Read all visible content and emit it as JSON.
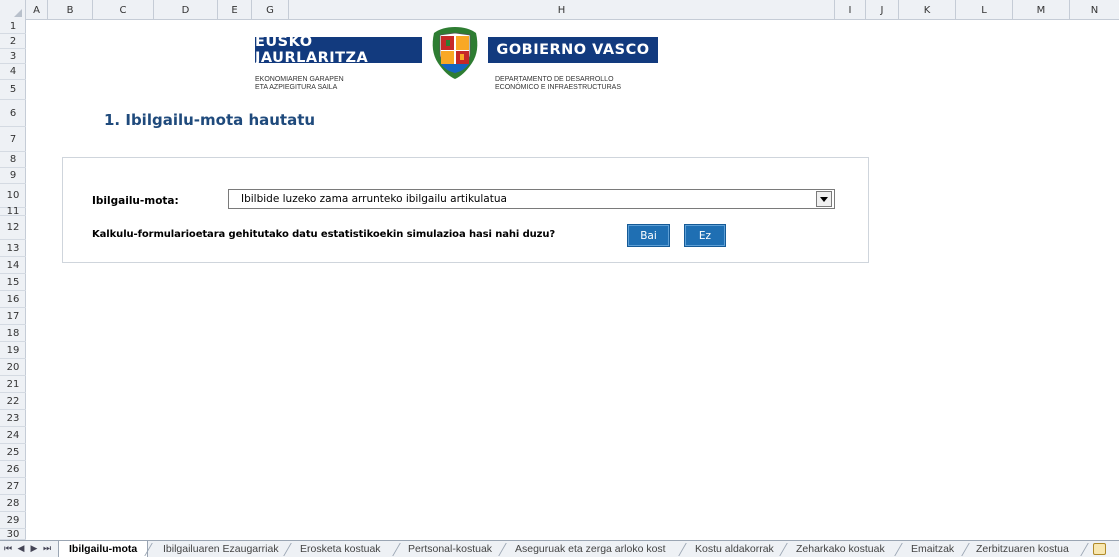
{
  "spreadsheet": {
    "columns": [
      "A",
      "B",
      "C",
      "D",
      "E",
      "G",
      "H",
      "I",
      "J",
      "K",
      "L",
      "M",
      "N"
    ],
    "rows": [
      "1",
      "2",
      "3",
      "4",
      "5",
      "6",
      "7",
      "8",
      "9",
      "10",
      "11",
      "12",
      "13",
      "14",
      "15",
      "16",
      "17",
      "18",
      "19",
      "20",
      "21",
      "22",
      "23",
      "24",
      "25",
      "26",
      "27",
      "28",
      "29",
      "30"
    ]
  },
  "logo": {
    "left_bar": "EUSKO JAURLARITZA",
    "right_bar": "GOBIERNO VASCO",
    "left_sub_1": "EKONOMIAREN GARAPEN",
    "left_sub_2": "ETA AZPIEGITURA SAILA",
    "right_sub_1": "DEPARTAMENTO DE DESARROLLO",
    "right_sub_2": "ECONÓMICO E INFRAESTRUCTURAS",
    "brand_color": "#123a7e"
  },
  "page": {
    "title": "1. Ibilgailu-mota hautatu"
  },
  "form": {
    "vehicle_type_label": "Ibilgailu-mota:",
    "vehicle_type_value": "Ibilbide luzeko zama arrunteko ibilgailu artikulatua",
    "question": "Kalkulu-formularioetara gehitutako datu estatistikoekin simulazioa hasi nahi duzu?",
    "yes_button": "Bai",
    "no_button": "Ez",
    "button_color": "#1f6fb3"
  },
  "tabs": {
    "nav_first": "⏮",
    "nav_prev": "◀",
    "nav_next": "▶",
    "nav_last": "⏭",
    "items": [
      "Ibilgailu-mota",
      "Ibilgailuaren Ezaugarriak",
      "Erosketa kostuak",
      "Pertsonal-kostuak",
      "Aseguruak eta zerga arloko kost",
      "Kostu aldakorrak",
      "Zeharkako kostuak",
      "Emaitzak",
      "Zerbitzuaren kostua"
    ],
    "active": "Ibilgailu-mota"
  }
}
